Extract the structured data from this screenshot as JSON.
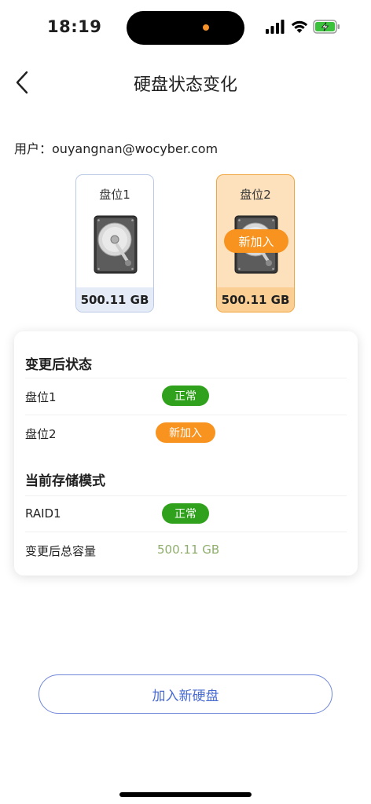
{
  "status_bar": {
    "time": "18:19"
  },
  "header": {
    "title": "硬盘状态变化"
  },
  "user": {
    "label": "用户：",
    "email": "ouyangnan@wocyber.com"
  },
  "slots": [
    {
      "label": "盘位1",
      "capacity": "500.11 GB"
    },
    {
      "label": "盘位2",
      "capacity": "500.11 GB",
      "badge": "新加入"
    }
  ],
  "card": {
    "changed_status_title": "变更后状态",
    "rows": [
      {
        "label": "盘位1",
        "status": "正常"
      },
      {
        "label": "盘位2",
        "status": "新加入"
      }
    ],
    "storage_mode_title": "当前存储模式",
    "mode_row": {
      "label": "RAID1",
      "status": "正常"
    },
    "capacity_row": {
      "label": "变更后总容量",
      "value": "500.11 GB"
    }
  },
  "footer": {
    "add_button": "加入新硬盘"
  },
  "colors": {
    "accent_blue": "#4a6cd0",
    "orange": "#f7931e",
    "green": "#30a11c"
  }
}
